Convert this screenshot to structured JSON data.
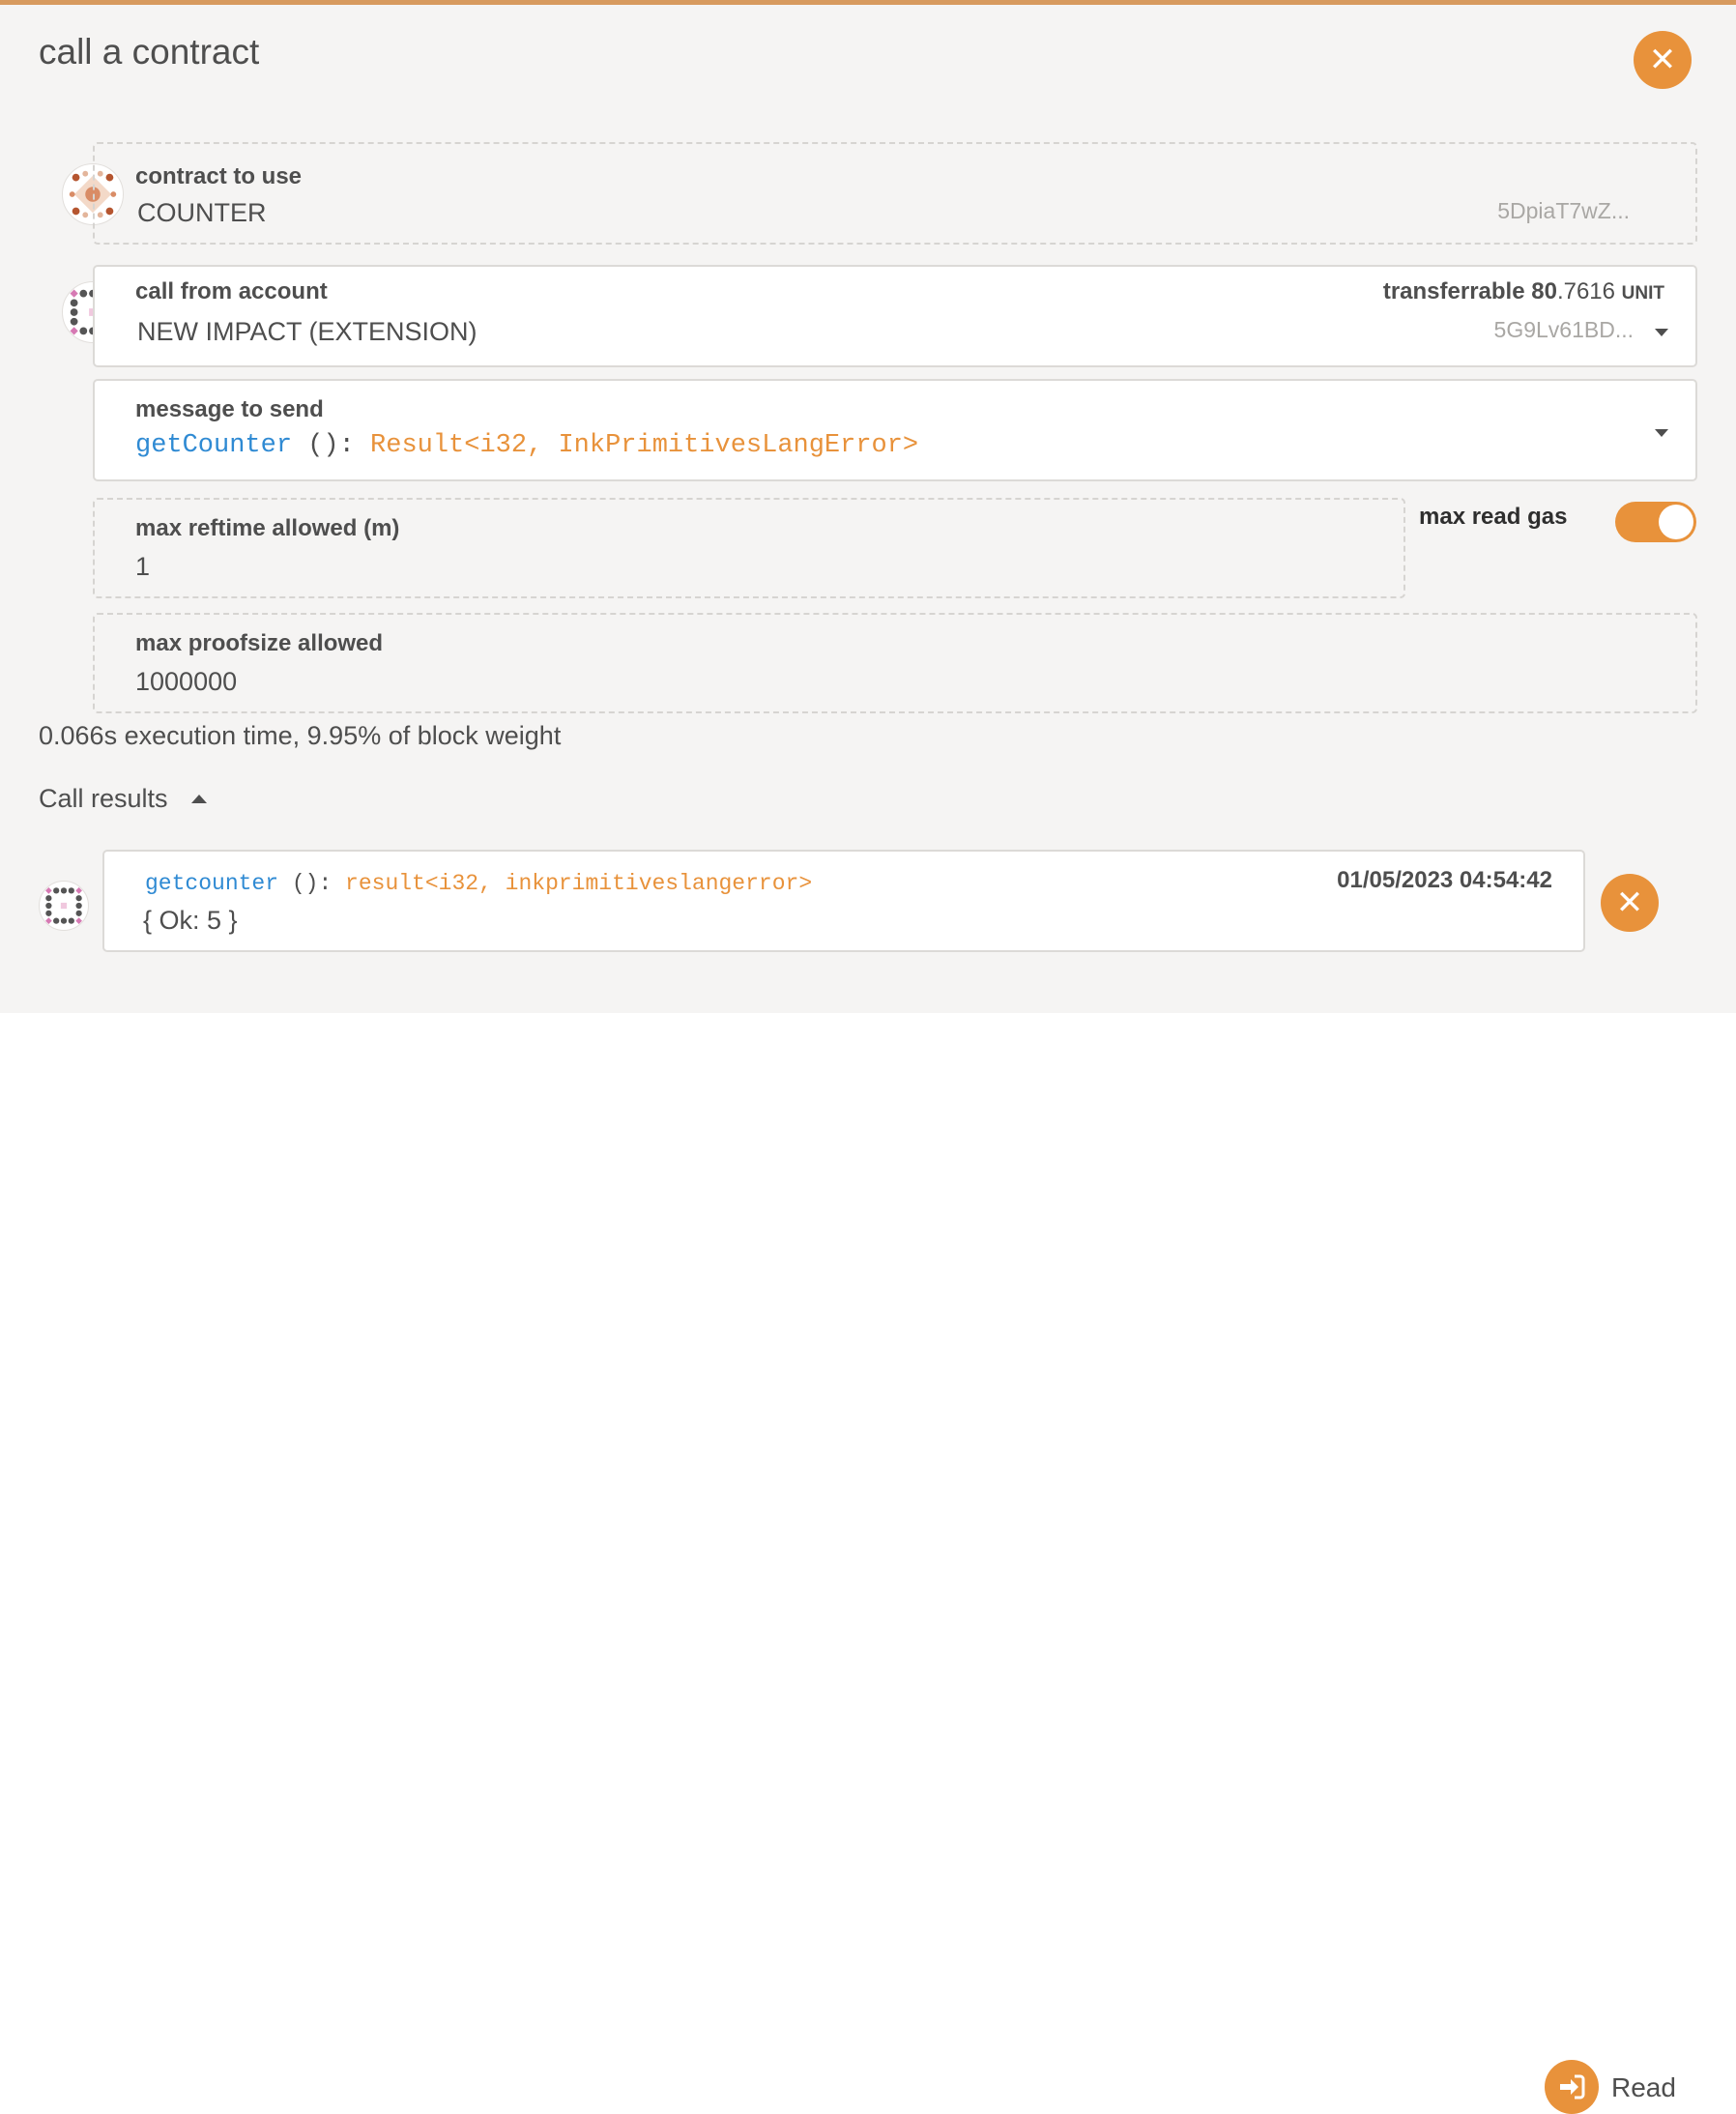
{
  "modal": {
    "title": "call a contract"
  },
  "contract": {
    "label": "contract to use",
    "name": "COUNTER",
    "address": "5DpiaT7wZ..."
  },
  "account": {
    "label": "call from account",
    "name": "NEW IMPACT (EXTENSION)",
    "address": "5G9Lv61BD...",
    "balance_label": "transferrable",
    "balance_int": "80",
    "balance_dec": ".7616",
    "balance_unit": "UNIT"
  },
  "message": {
    "label": "message to send",
    "method": "getCounter",
    "args": " (): ",
    "returns": "Result<i32, InkPrimitivesLangError>"
  },
  "reftime": {
    "label": "max reftime allowed (m)",
    "value": "1"
  },
  "max_read_gas": {
    "label": "max read gas",
    "enabled": true
  },
  "proofsize": {
    "label": "max proofsize allowed",
    "value": "1000000"
  },
  "exec_info": "0.066s execution time, 9.95% of block weight",
  "call_results": {
    "title": "Call results",
    "items": [
      {
        "method": "getcounter",
        "args": " (): ",
        "returns": "result<i32, inkprimitiveslangerror>",
        "timestamp": "01/05/2023 04:54:42",
        "output": "{ Ok: 5 }"
      }
    ]
  },
  "actions": {
    "read_label": "Read"
  },
  "colors": {
    "accent": "#e8923b",
    "method_blue": "#2f8ad3",
    "panel_bg": "#f5f4f3"
  },
  "icons": {
    "close": "close-icon",
    "dropdown": "chevron-down-icon",
    "collapse": "chevron-up-icon",
    "read": "sign-in-icon",
    "identicon": "identicon"
  }
}
